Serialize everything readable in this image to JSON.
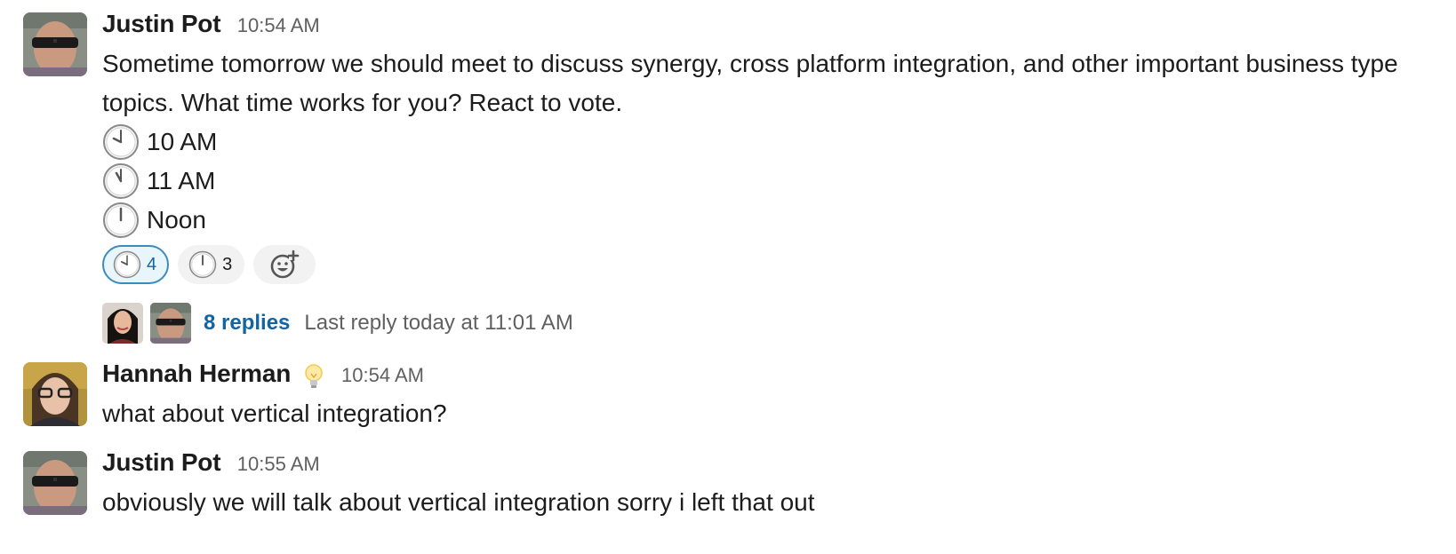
{
  "messages": [
    {
      "author": "Justin Pot",
      "time": "10:54 AM",
      "text": "Sometime tomorrow we should meet to discuss synergy, cross platform integration, and other important business type topics. What time works for you? React to vote.",
      "options": [
        {
          "icon": "clock-1000-icon",
          "label": "10 AM"
        },
        {
          "icon": "clock-1100-icon",
          "label": "11 AM"
        },
        {
          "icon": "clock-1200-icon",
          "label": "Noon"
        }
      ],
      "reactions": [
        {
          "icon": "clock-1000-icon",
          "count": "4",
          "active": true
        },
        {
          "icon": "clock-1200-icon",
          "count": "3",
          "active": false
        }
      ],
      "add_reaction_icon": "add-reaction-icon",
      "thread": {
        "replies": "8 replies",
        "last_reply": "Last reply today at 11:01 AM"
      }
    },
    {
      "author": "Hannah Herman",
      "status_icon": "lightbulb-icon",
      "time": "10:54 AM",
      "text": "what about vertical integration?"
    },
    {
      "author": "Justin Pot",
      "time": "10:55 AM",
      "text": "obviously we will talk about vertical integration sorry i left that out"
    }
  ],
  "colors": {
    "link": "#1264a3",
    "reaction_active_border": "#3b8bbd",
    "reaction_active_bg": "#e8f5fa",
    "muted_text": "#616061"
  }
}
